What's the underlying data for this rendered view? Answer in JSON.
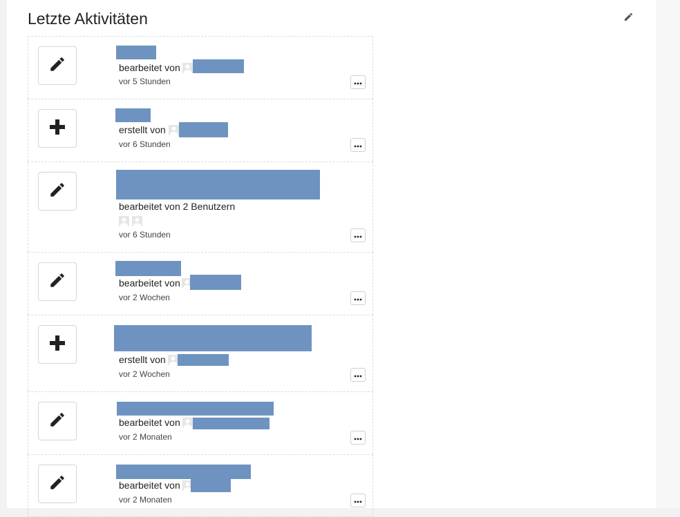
{
  "header": {
    "title": "Letzte Aktivitäten",
    "edit_icon": "pencil-icon"
  },
  "activities": [
    {
      "icon": "pencil-icon",
      "action_text": "bearbeitet von",
      "time": "vor 5 Stunden"
    },
    {
      "icon": "plus-icon",
      "action_text": "erstellt von",
      "time": "vor 6 Stunden"
    },
    {
      "icon": "pencil-icon",
      "action_text": "bearbeitet von 2 Benutzern",
      "time": "vor 6 Stunden"
    },
    {
      "icon": "pencil-icon",
      "action_text": "bearbeitet von",
      "time": "vor 2 Wochen"
    },
    {
      "icon": "plus-icon",
      "action_text": "erstellt von",
      "time": "vor 2 Wochen"
    },
    {
      "icon": "pencil-icon",
      "action_text": "bearbeitet von",
      "time": "vor 2 Monaten"
    },
    {
      "icon": "pencil-icon",
      "action_text": "bearbeitet von",
      "time": "vor 2 Monaten"
    }
  ],
  "colors": {
    "redaction": "#6e93c0",
    "icon": "#222222"
  }
}
